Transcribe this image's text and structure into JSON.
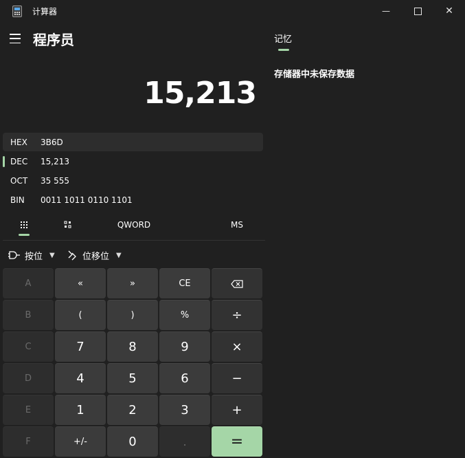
{
  "window": {
    "title": "计算器",
    "minimize_glyph": "—",
    "maximize_glyph": "☐",
    "close_glyph": "✕"
  },
  "header": {
    "mode_title": "程序员"
  },
  "display": {
    "value": "15,213"
  },
  "radix": [
    {
      "label": "HEX",
      "value": "3B6D",
      "selected": false
    },
    {
      "label": "DEC",
      "value": "15,213",
      "selected": true
    },
    {
      "label": "OCT",
      "value": "35 555",
      "selected": false
    },
    {
      "label": "BIN",
      "value": "0011 1011 0110 1101",
      "selected": false
    }
  ],
  "tabs": {
    "word_size": "QWORD",
    "memory_store": "MS"
  },
  "toolbar": {
    "bitwise_label": "按位",
    "bitshift_label": "位移位"
  },
  "keypad": {
    "rows": [
      [
        "A",
        "«",
        "»",
        "CE",
        "⌫"
      ],
      [
        "B",
        "(",
        ")",
        "%",
        "÷"
      ],
      [
        "C",
        "7",
        "8",
        "9",
        "×"
      ],
      [
        "D",
        "4",
        "5",
        "6",
        "−"
      ],
      [
        "E",
        "1",
        "2",
        "3",
        "+"
      ],
      [
        "F",
        "+/-",
        "0",
        ".",
        "="
      ]
    ]
  },
  "memory": {
    "tab_label": "记忆",
    "empty_message": "存储器中未保存数据"
  },
  "colors": {
    "accent": "#a5d6a7",
    "background": "#202020",
    "button": "#3b3b3b",
    "button_disabled": "#2d2d2d"
  }
}
